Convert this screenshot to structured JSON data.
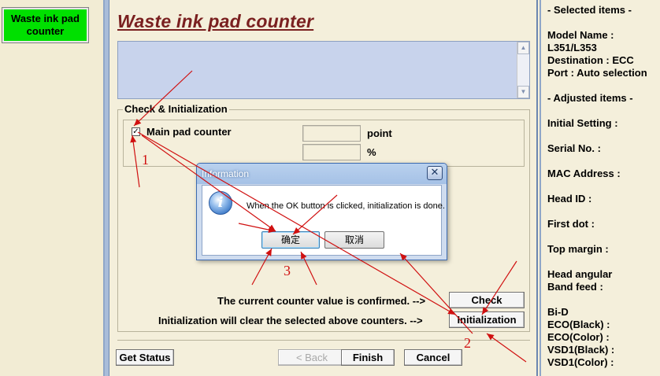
{
  "left_nav": {
    "item_label": "Waste ink pad counter",
    "item_color": "#00e000"
  },
  "main": {
    "title": "Waste ink pad counter",
    "check_group": {
      "legend": "Check & Initialization",
      "main_pad_label": "Main pad counter",
      "main_pad_checked": true,
      "checkmark": "✓",
      "unit_point": "point",
      "unit_percent": "%",
      "point_value": "",
      "percent_value": ""
    },
    "check_msg": "The current counter value is confirmed. -->",
    "check_btn": "Check",
    "init_msg": "Initialization will clear the selected above counters. -->",
    "init_btn": "Initialization",
    "footer": {
      "get_status": "Get Status",
      "back": "< Back",
      "finish": "Finish",
      "cancel": "Cancel"
    }
  },
  "right_panel": {
    "selected_header": "- Selected items -",
    "model_label": "Model Name :",
    "model_value": "L351/L353",
    "destination": "Destination : ECC",
    "port": "Port : Auto selection",
    "adjusted_header": "- Adjusted items -",
    "initial_setting": "Initial Setting :",
    "serial_no": "Serial No. :",
    "mac_address": "MAC Address :",
    "head_id": "Head ID :",
    "first_dot": "First dot :",
    "top_margin": "Top margin :",
    "head_angular": "Head angular",
    "band_feed": " Band feed :",
    "bi_d": "Bi-D",
    "eco_black": " ECO(Black)  :",
    "eco_color": " ECO(Color)  :",
    "vsd1_black": " VSD1(Black) :",
    "vsd1_color": " VSD1(Color) :"
  },
  "dialog": {
    "title": "Information",
    "close_glyph": "✕",
    "icon_glyph": "i",
    "message": "When the OK button is clicked, initialization is done.",
    "ok": "确定",
    "cancel": "取消"
  },
  "annotations": {
    "n1": "1",
    "n2": "2",
    "n3": "3",
    "color": "#d01010"
  }
}
